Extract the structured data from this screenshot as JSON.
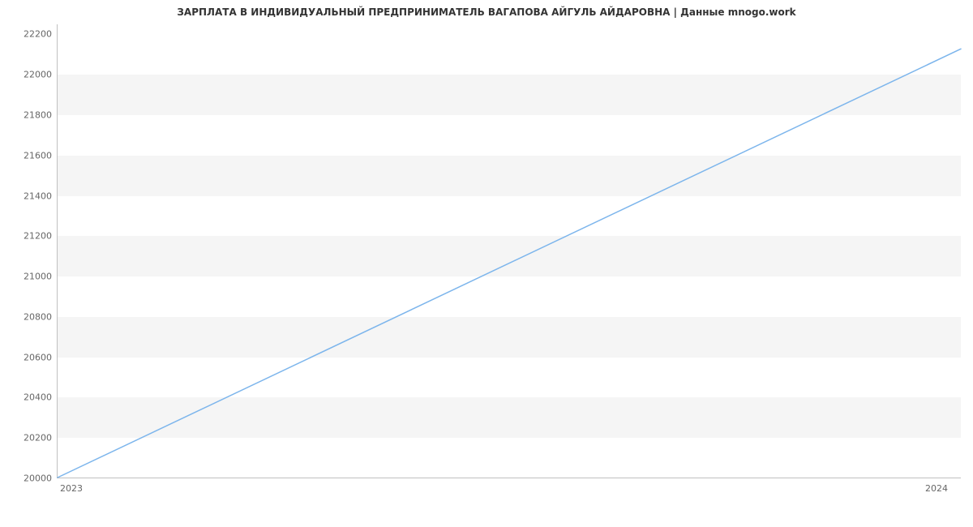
{
  "chart_data": {
    "type": "line",
    "title": "ЗАРПЛАТА В ИНДИВИДУАЛЬНЫЙ ПРЕДПРИНИМАТЕЛЬ ВАГАПОВА АЙГУЛЬ АЙДАРОВНА | Данные mnogo.work",
    "xlabel": "",
    "ylabel": "",
    "categories": [
      "2023",
      "2024"
    ],
    "x": [
      2023,
      2024
    ],
    "values": [
      20000,
      22128
    ],
    "y_ticks": [
      20000,
      20200,
      20400,
      20600,
      20800,
      21000,
      21200,
      21400,
      21600,
      21800,
      22000,
      22200
    ],
    "ylim": [
      20000,
      22250
    ],
    "series_color": "#7cb5ec",
    "band_color": "#f5f5f5"
  }
}
